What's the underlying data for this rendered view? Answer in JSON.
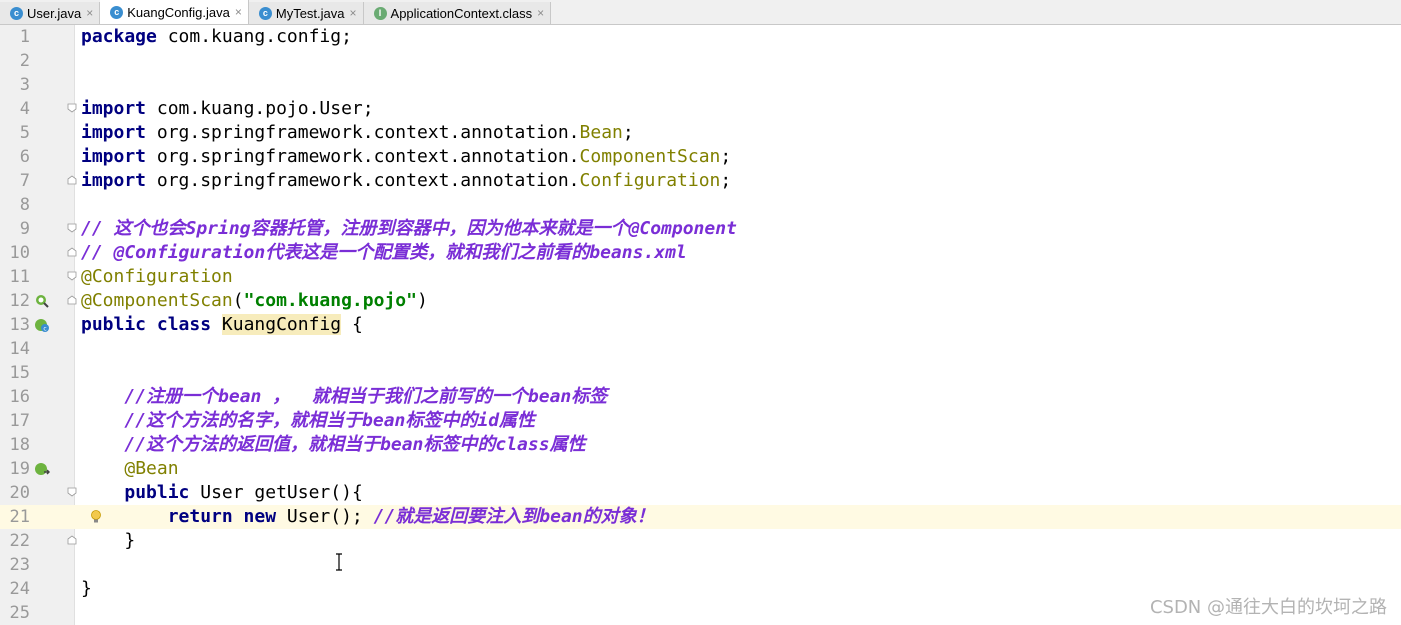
{
  "tabs": [
    {
      "name": "User.java",
      "icon": "c",
      "color": "#3a8ed0",
      "active": false
    },
    {
      "name": "KuangConfig.java",
      "icon": "c",
      "color": "#3a8ed0",
      "active": true
    },
    {
      "name": "MyTest.java",
      "icon": "c",
      "color": "#3a8ed0",
      "active": false
    },
    {
      "name": "ApplicationContext.class",
      "icon": "I",
      "color": "#6aab73",
      "active": false
    }
  ],
  "close_glyph": "×",
  "current_line": 21,
  "lines": [
    {
      "n": "1",
      "tokens": [
        [
          "kw",
          "package"
        ],
        [
          "",
          " com.kuang.config;"
        ]
      ]
    },
    {
      "n": "2",
      "tokens": []
    },
    {
      "n": "3",
      "tokens": []
    },
    {
      "n": "4",
      "fold": "open",
      "tokens": [
        [
          "kw",
          "import"
        ],
        [
          "",
          " com.kuang.pojo.User;"
        ]
      ]
    },
    {
      "n": "5",
      "tokens": [
        [
          "kw",
          "import"
        ],
        [
          "",
          " org.springframework.context.annotation."
        ],
        [
          "ann",
          "Bean"
        ],
        [
          "",
          ";"
        ]
      ]
    },
    {
      "n": "6",
      "tokens": [
        [
          "kw",
          "import"
        ],
        [
          "",
          " org.springframework.context.annotation."
        ],
        [
          "ann",
          "ComponentScan"
        ],
        [
          "",
          ";"
        ]
      ]
    },
    {
      "n": "7",
      "fold": "close",
      "tokens": [
        [
          "kw",
          "import"
        ],
        [
          "",
          " org.springframework.context.annotation."
        ],
        [
          "ann",
          "Configuration"
        ],
        [
          "",
          ";"
        ]
      ]
    },
    {
      "n": "8",
      "tokens": []
    },
    {
      "n": "9",
      "fold": "open",
      "tokens": [
        [
          "cmt",
          "// 这个也会Spring容器托管，注册到容器中，因为他本来就是一个@Component"
        ]
      ]
    },
    {
      "n": "10",
      "fold": "close",
      "tokens": [
        [
          "cmt",
          "// @Configuration代表这是一个配置类，就和我们之前看的beans.xml"
        ]
      ]
    },
    {
      "n": "11",
      "fold": "open",
      "tokens": [
        [
          "ann",
          "@Configuration"
        ]
      ]
    },
    {
      "n": "12",
      "fold": "close",
      "gicon": "scan",
      "tokens": [
        [
          "ann",
          "@ComponentScan"
        ],
        [
          "",
          "("
        ],
        [
          "str",
          "\"com.kuang.pojo\""
        ],
        [
          "",
          ")"
        ]
      ]
    },
    {
      "n": "13",
      "gicon": "bean",
      "tokens": [
        [
          "kw",
          "public class"
        ],
        [
          "",
          " "
        ],
        [
          "hl",
          "KuangConfig"
        ],
        [
          "",
          " {"
        ]
      ]
    },
    {
      "n": "14",
      "tokens": []
    },
    {
      "n": "15",
      "tokens": []
    },
    {
      "n": "16",
      "tokens": [
        [
          "",
          "    "
        ],
        [
          "cmt",
          "//注册一个bean ，  就相当于我们之前写的一个bean标签"
        ]
      ]
    },
    {
      "n": "17",
      "tokens": [
        [
          "",
          "    "
        ],
        [
          "cmt",
          "//这个方法的名字，就相当于bean标签中的id属性"
        ]
      ]
    },
    {
      "n": "18",
      "tokens": [
        [
          "",
          "    "
        ],
        [
          "cmt",
          "//这个方法的返回值，就相当于bean标签中的class属性"
        ]
      ]
    },
    {
      "n": "19",
      "gicon": "beanmethod",
      "tokens": [
        [
          "",
          "    "
        ],
        [
          "ann",
          "@Bean"
        ]
      ]
    },
    {
      "n": "20",
      "fold": "open",
      "tokens": [
        [
          "",
          "    "
        ],
        [
          "kw",
          "public"
        ],
        [
          "",
          " User getUser(){"
        ]
      ]
    },
    {
      "n": "21",
      "gicon": "bulb",
      "tokens": [
        [
          "",
          "        "
        ],
        [
          "kw",
          "return new"
        ],
        [
          "",
          " User(); "
        ],
        [
          "cmt",
          "//就是返回要注入到bean的对象！"
        ]
      ]
    },
    {
      "n": "22",
      "fold": "close",
      "tokens": [
        [
          "",
          "    }"
        ]
      ]
    },
    {
      "n": "23",
      "tokens": []
    },
    {
      "n": "24",
      "tokens": [
        [
          "",
          "}"
        ]
      ]
    },
    {
      "n": "25",
      "tokens": []
    }
  ],
  "watermark": "CSDN @通往大白的坎坷之路"
}
